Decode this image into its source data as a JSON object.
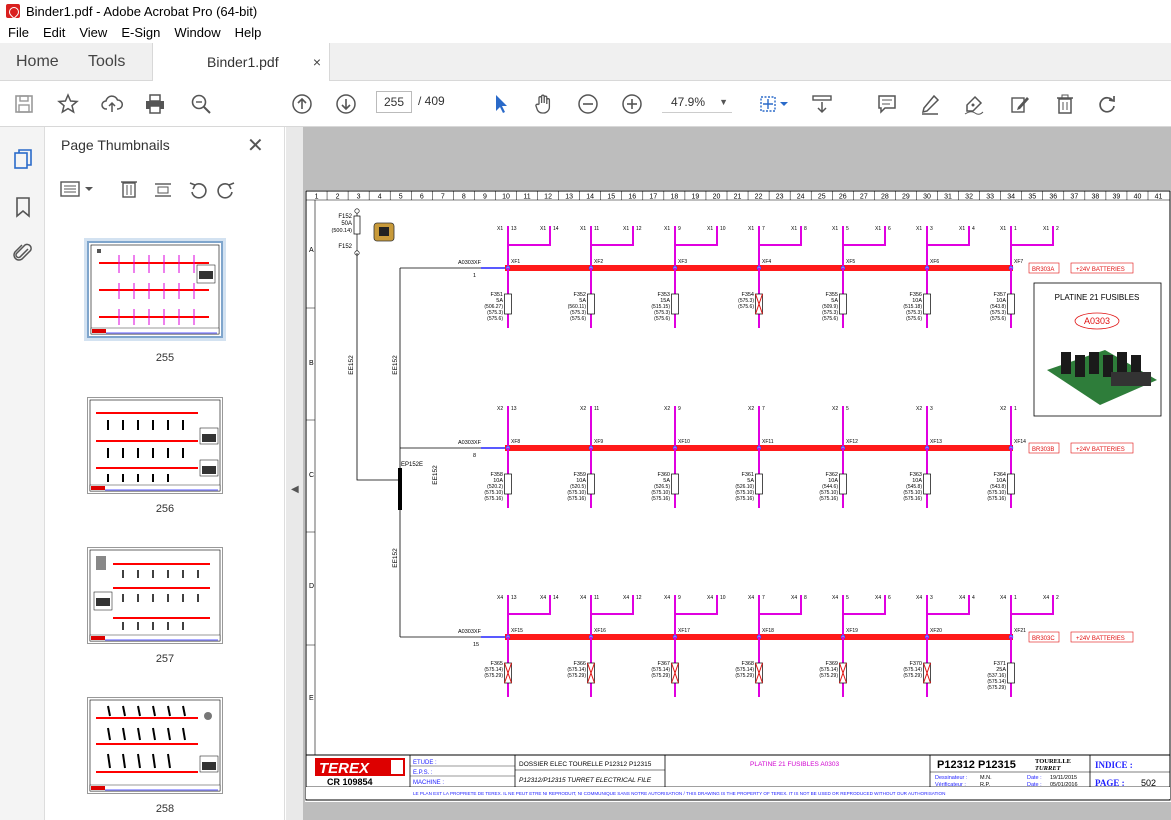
{
  "window": {
    "title": "Binder1.pdf - Adobe Acrobat Pro (64-bit)"
  },
  "menu": [
    "File",
    "Edit",
    "View",
    "E-Sign",
    "Window",
    "Help"
  ],
  "tabs": {
    "home": "Home",
    "tools": "Tools",
    "document": "Binder1.pdf",
    "close": "×"
  },
  "toolbar": {
    "page_current": "255",
    "page_total": "/ 409",
    "zoom": "47.9%"
  },
  "thumbnails": {
    "header": "Page Thumbnails",
    "pages": [
      {
        "label": "255",
        "selected": true
      },
      {
        "label": "256",
        "selected": false
      },
      {
        "label": "257",
        "selected": false
      },
      {
        "label": "258",
        "selected": false
      }
    ]
  },
  "drawing": {
    "columns": [
      "1",
      "2",
      "3",
      "4",
      "5",
      "6",
      "7",
      "8",
      "9",
      "10",
      "11",
      "12",
      "13",
      "14",
      "15",
      "16",
      "17",
      "18",
      "19",
      "20",
      "21",
      "22",
      "23",
      "24",
      "25",
      "26",
      "27",
      "28",
      "29",
      "30",
      "31",
      "32",
      "33",
      "34",
      "35",
      "36",
      "37",
      "38",
      "39",
      "40",
      "41"
    ],
    "rows": [
      "A",
      "B",
      "C",
      "D",
      "E"
    ],
    "main_fuse": {
      "label": "F152",
      "value": "50A",
      "ref": "(500.14)",
      "bottom": "F152"
    },
    "cable_labels": [
      "EE152",
      "EE152",
      "EE152",
      "EE152"
    ],
    "splice": "EP152E",
    "panel": {
      "title": "PLATINE 21 FUSIBLES",
      "ref": "A0303"
    },
    "rows_data": [
      {
        "connector": "A0303XF",
        "pin": "1",
        "end_ref": "BR303A",
        "battery": "+24V BATTERIES",
        "terminals": [
          "XF1",
          "XF2",
          "XF3",
          "XF4",
          "XF5",
          "XF6",
          "XF7"
        ],
        "tops": [
          [
            "X1",
            "13",
            "X1",
            "14"
          ],
          [
            "X1",
            "11",
            "X1",
            "12"
          ],
          [
            "X1",
            "9",
            "X1",
            "10"
          ],
          [
            "X1",
            "7",
            "X1",
            "8"
          ],
          [
            "X1",
            "5",
            "X1",
            "6"
          ],
          [
            "X1",
            "3",
            "X1",
            "4"
          ],
          [
            "X1",
            "1",
            "X1",
            "2"
          ]
        ],
        "fuses": [
          {
            "name": "F351",
            "rating": "5A",
            "refs": [
              "(506.27)",
              "(575.3)",
              "(575.6)"
            ],
            "blown": false
          },
          {
            "name": "F352",
            "rating": "5A",
            "refs": [
              "(560.11)",
              "(575.3)",
              "(575.6)"
            ],
            "blown": false
          },
          {
            "name": "F353",
            "rating": "15A",
            "refs": [
              "(515.15)",
              "(575.3)",
              "(575.6)"
            ],
            "blown": false
          },
          {
            "name": "F354",
            "rating": "",
            "refs": [
              "(575.3)",
              "(575.6)"
            ],
            "blown": true
          },
          {
            "name": "F355",
            "rating": "5A",
            "refs": [
              "(509.9)",
              "(575.3)",
              "(575.6)"
            ],
            "blown": false
          },
          {
            "name": "F356",
            "rating": "10A",
            "refs": [
              "(515.18)",
              "(575.3)",
              "(575.6)"
            ],
            "blown": false
          },
          {
            "name": "F357",
            "rating": "10A",
            "refs": [
              "(543.8)",
              "(575.3)",
              "(575.6)"
            ],
            "blown": false
          }
        ]
      },
      {
        "connector": "A0303XF",
        "pin": "8",
        "end_ref": "BR303B",
        "battery": "+24V BATTERIES",
        "terminals": [
          "XF8",
          "XF9",
          "XF10",
          "XF11",
          "XF12",
          "XF13",
          "XF14"
        ],
        "tops": [
          [
            "X2",
            "13"
          ],
          [
            "X2",
            "11"
          ],
          [
            "X2",
            "9"
          ],
          [
            "X2",
            "7"
          ],
          [
            "X2",
            "5"
          ],
          [
            "X2",
            "3"
          ],
          [
            "X2",
            "1"
          ]
        ],
        "fuses": [
          {
            "name": "F358",
            "rating": "10A",
            "refs": [
              "(520.2)",
              "(575.10)",
              "(575.16)"
            ],
            "blown": false
          },
          {
            "name": "F359",
            "rating": "10A",
            "refs": [
              "(520.5)",
              "(575.10)",
              "(575.16)"
            ],
            "blown": false
          },
          {
            "name": "F360",
            "rating": "5A",
            "refs": [
              "(526.5)",
              "(575.10)",
              "(575.16)"
            ],
            "blown": false
          },
          {
            "name": "F361",
            "rating": "5A",
            "refs": [
              "(526.10)",
              "(575.10)",
              "(575.16)"
            ],
            "blown": false
          },
          {
            "name": "F362",
            "rating": "10A",
            "refs": [
              "(544.6)",
              "(575.10)",
              "(575.16)"
            ],
            "blown": false
          },
          {
            "name": "F363",
            "rating": "10A",
            "refs": [
              "(545.8)",
              "(575.10)",
              "(575.16)"
            ],
            "blown": false
          },
          {
            "name": "F364",
            "rating": "10A",
            "refs": [
              "(543.8)",
              "(575.10)",
              "(575.16)"
            ],
            "blown": false
          }
        ]
      },
      {
        "connector": "A0303XF",
        "pin": "15",
        "end_ref": "BR303C",
        "battery": "+24V BATTERIES",
        "terminals": [
          "XF15",
          "XF16",
          "XF17",
          "XF18",
          "XF19",
          "XF20",
          "XF21"
        ],
        "tops": [
          [
            "X4",
            "13",
            "X4",
            "14"
          ],
          [
            "X4",
            "11",
            "X4",
            "12"
          ],
          [
            "X4",
            "9",
            "X4",
            "10"
          ],
          [
            "X4",
            "7",
            "X4",
            "8"
          ],
          [
            "X4",
            "5",
            "X4",
            "6"
          ],
          [
            "X4",
            "3",
            "X4",
            "4"
          ],
          [
            "X4",
            "1",
            "X4",
            "2"
          ]
        ],
        "fuses": [
          {
            "name": "F365",
            "rating": "",
            "refs": [
              "(575.14)",
              "(575.29)"
            ],
            "blown": true
          },
          {
            "name": "F366",
            "rating": "",
            "refs": [
              "(575.14)",
              "(575.29)"
            ],
            "blown": true
          },
          {
            "name": "F367",
            "rating": "",
            "refs": [
              "(575.14)",
              "(575.29)"
            ],
            "blown": true
          },
          {
            "name": "F368",
            "rating": "",
            "refs": [
              "(575.14)",
              "(575.29)"
            ],
            "blown": true
          },
          {
            "name": "F369",
            "rating": "",
            "refs": [
              "(575.14)",
              "(575.29)"
            ],
            "blown": true
          },
          {
            "name": "F370",
            "rating": "",
            "refs": [
              "(575.14)",
              "(575.29)"
            ],
            "blown": true
          },
          {
            "name": "F371",
            "rating": "25A",
            "refs": [
              "(537.16)",
              "(575.14)",
              "(575.29)"
            ],
            "blown": false
          }
        ]
      }
    ],
    "titleblock": {
      "logo": "TEREX",
      "etude": "ETUDE :",
      "eps": "E.P.S. :",
      "machine": "MACHINE :",
      "dossier": "DOSSIER ELEC TOURELLE P12312 P12315",
      "turret": "P12312/P12315 TURRET ELECTRICAL FILE",
      "platine": "PLATINE 21 FUSIBLES A0303",
      "model": "P12312 P12315",
      "tourelle": "TOURELLE",
      "turret_word": "TURRET",
      "indice": "INDICE :",
      "dessinateur": "Dessinateur :",
      "dessinateur_val": "M.N.",
      "verificateur": "Vérificateur :",
      "verificateur_val": "R.P.",
      "date1_lbl": "Date :",
      "date1": "19/11/2015",
      "date2_lbl": "Date :",
      "date2": "05/01/2016",
      "page_lbl": "PAGE :",
      "page": "502",
      "cr": "CR 109854",
      "notice": "LE PLAN EST LA PROPRIETE DE TEREX. IL NE PEUT ETRE NI REPRODUIT, NI COMMUNIQUE SANS NOTRE AUTORISATION / THIS DRAWING IS THE PROPERTY OF TEREX. IT IS NOT BE USED OR REPRODUCED WITHOUT OUR AUTHORISATION"
    }
  },
  "colors": {
    "busbar": "#ff1a1a",
    "wire": "#e000e0",
    "accent": "#2a6ac9",
    "titleblock_red": "#e01010"
  }
}
